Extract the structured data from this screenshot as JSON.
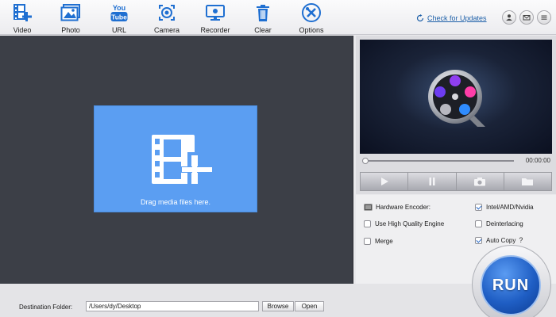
{
  "colors": {
    "toolbar_icon": "#1f6fd1",
    "media_background": "#3c3f47",
    "drop_zone": "#5b9ef2",
    "link": "#1c5fa8",
    "run_button": "#1f5ec4"
  },
  "toolbar": {
    "video_label": "Video",
    "photo_label": "Photo",
    "url_label": "URL",
    "url_icon_text": "You Tube",
    "camera_label": "Camera",
    "recorder_label": "Recorder",
    "clear_label": "Clear",
    "options_label": "Options",
    "check_updates": "Check for Updates",
    "account_icon": "user-icon",
    "mail_icon": "mail-icon",
    "menu_icon": "menu-icon"
  },
  "drop_zone": {
    "text": "Drag media files here.",
    "icon": "add-media-icon"
  },
  "preview": {
    "time": "00:00:00",
    "playback_progress": 0,
    "controls": [
      "play-icon",
      "pause-icon",
      "snapshot-icon",
      "open-folder-icon"
    ]
  },
  "options": {
    "hardware_encoder_label": "Hardware Encoder:",
    "intel_label": "Intel/AMD/Nvidia",
    "intel_checked": true,
    "hq_engine_label": "Use High Quality Engine",
    "hq_engine_checked": false,
    "deinterlacing_label": "Deinterlacing",
    "deinterlacing_checked": false,
    "merge_label": "Merge",
    "merge_checked": false,
    "auto_copy_label": "Auto Copy",
    "auto_copy_checked": true,
    "help_mark": "?"
  },
  "destination": {
    "label": "Destination Folder:",
    "path": "/Users/dy/Desktop",
    "browse_label": "Browse",
    "open_label": "Open"
  },
  "run": {
    "label": "RUN"
  }
}
